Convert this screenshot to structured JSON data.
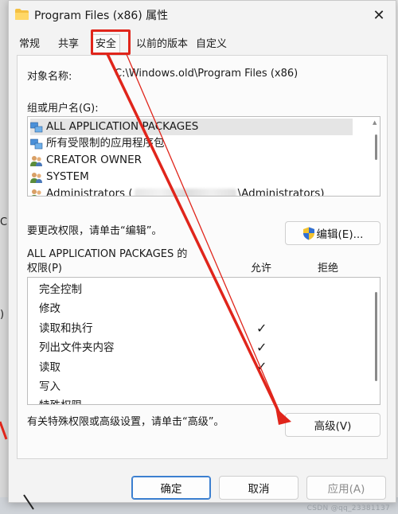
{
  "window": {
    "title": "Program Files (x86) 属性",
    "close_glyph": "✕"
  },
  "tabs": [
    {
      "label": "常规"
    },
    {
      "label": "共享"
    },
    {
      "label": "安全"
    },
    {
      "label": "以前的版本"
    },
    {
      "label": "自定义"
    }
  ],
  "active_tab": "安全",
  "security": {
    "object_name_label": "对象名称:",
    "object_name_value": "C:\\Windows.old\\Program Files (x86)",
    "groups_label": "组或用户名(G):",
    "groups": [
      {
        "name": "ALL APPLICATION PACKAGES",
        "icon": "app-packages-icon",
        "selected": true
      },
      {
        "name": "所有受限制的应用程序包",
        "icon": "app-packages-icon"
      },
      {
        "name": "CREATOR OWNER",
        "icon": "users-icon"
      },
      {
        "name": "SYSTEM",
        "icon": "users-icon"
      },
      {
        "name_prefix": "Administrators (",
        "name_suffix": "\\Administrators)",
        "icon": "users-icon",
        "redacted": true
      }
    ],
    "change_text": "要更改权限，请单击“编辑”。",
    "edit_button": "编辑(E)...",
    "perm_title_line1": "ALL APPLICATION PACKAGES 的",
    "perm_title_line2": "权限(P)",
    "allow_header": "允许",
    "deny_header": "拒绝",
    "permissions": [
      {
        "name": "完全控制",
        "allow": false
      },
      {
        "name": "修改",
        "allow": false
      },
      {
        "name": "读取和执行",
        "allow": true
      },
      {
        "name": "列出文件夹内容",
        "allow": true
      },
      {
        "name": "读取",
        "allow": true
      },
      {
        "name": "写入",
        "allow": false
      },
      {
        "name": "特殊权限",
        "allow": false
      }
    ],
    "check_glyph": "✓",
    "advanced_text": "有关特殊权限或高级设置，请单击“高级”。",
    "advanced_button": "高级(V)"
  },
  "footer": {
    "ok": "确定",
    "cancel": "取消",
    "apply": "应用(A)"
  },
  "watermark": "CSDN @qq_23381137",
  "colors": {
    "annotation_red": "#e0251b",
    "primary_border": "#3b7fd0"
  }
}
